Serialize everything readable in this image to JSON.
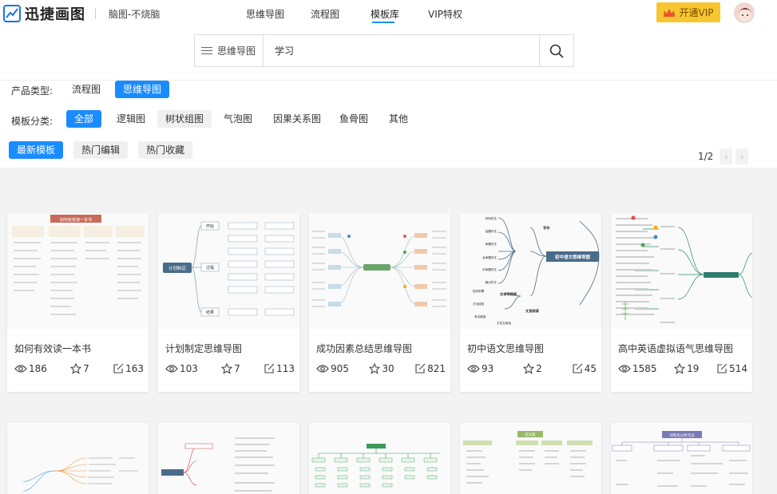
{
  "brand": {
    "name": "迅捷画图",
    "tagline": "脑图-不烧脑"
  },
  "nav": [
    "思维导图",
    "流程图",
    "模板库",
    "VIP特权"
  ],
  "vip_button": "开通VIP",
  "search": {
    "category": "思维导图",
    "value": "学习"
  },
  "filters": {
    "product_label": "产品类型:",
    "product_types": [
      "流程图",
      "思维导图"
    ],
    "category_label": "模板分类:",
    "categories": [
      "全部",
      "逻辑图",
      "树状组图",
      "气泡图",
      "因果关系图",
      "鱼骨图",
      "其他"
    ],
    "sort_tabs": [
      "最新模板",
      "热门编辑",
      "热门收藏"
    ]
  },
  "pagination": {
    "text": "1/2"
  },
  "cards": [
    {
      "title": "如何有效读一本书",
      "views": "186",
      "stars": "7",
      "edits": "163"
    },
    {
      "title": "计划制定思维导图",
      "views": "103",
      "stars": "7",
      "edits": "113"
    },
    {
      "title": "成功因素总结思维导图",
      "views": "905",
      "stars": "30",
      "edits": "821"
    },
    {
      "title": "初中语文思维导图",
      "views": "93",
      "stars": "2",
      "edits": "45"
    },
    {
      "title": "高中英语虚拟语气思维导图",
      "views": "1585",
      "stars": "19",
      "edits": "514"
    }
  ],
  "thumb_text": {
    "card1_header": "如何有效读一本书",
    "card2_center": "计划制定",
    "card2_nodes": [
      "开始",
      "过程",
      "结果"
    ],
    "card4_center": "初中语文思维导图",
    "card4_nodes": [
      "写作",
      "古诗词阅读",
      "文言阅读"
    ],
    "card4_left": [
      "材料作文",
      "话题作文",
      "命题作文",
      "全命题作文",
      "半命题作文",
      "随记作文",
      "知识积累",
      "方法经验",
      "考点链接",
      "文言文阅读"
    ],
    "row2_card4_header": "名词复",
    "row2_card5_header": "词性及分析句法"
  },
  "colors": {
    "accent": "#1a8cff",
    "vip": "#f7c631"
  },
  "icons": [
    "logo-icon",
    "menu-icon",
    "search-icon",
    "crown-icon",
    "avatar",
    "eye-icon",
    "star-icon",
    "edit-icon",
    "chevron-left-icon",
    "chevron-right-icon"
  ]
}
